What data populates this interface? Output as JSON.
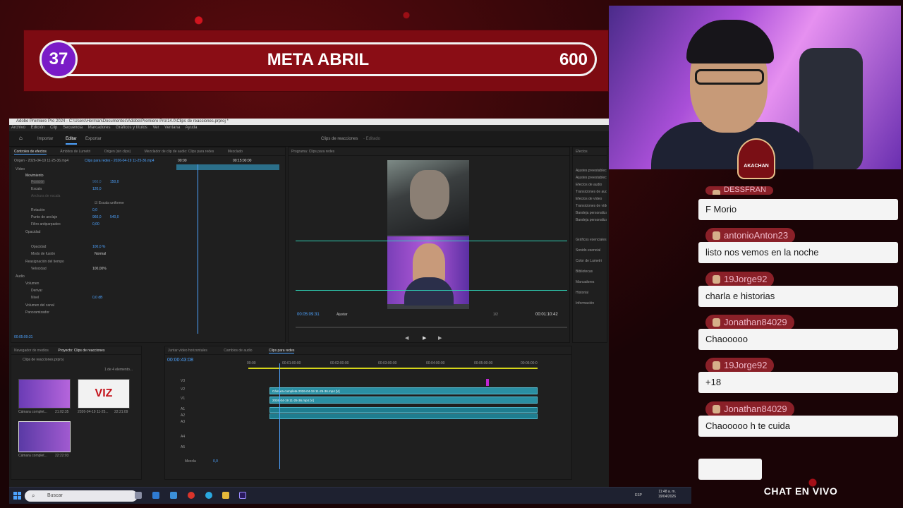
{
  "goal": {
    "current": "37",
    "title": "META ABRIL",
    "target": "600"
  },
  "premiere": {
    "window_title": "Adobe Premiere Pro 2024 - C:\\Users\\Herman\\Documentos\\Adobe\\Premiere Pro\\14.0\\Clips de reacciones.prproj *",
    "menu": [
      "Archivo",
      "Edición",
      "Clip",
      "Secuencia",
      "Marcadores",
      "Gráficos y títulos",
      "Ver",
      "Ventana",
      "Ayuda"
    ],
    "workspace_tabs": {
      "inicio": "⌂",
      "importar": "Importar",
      "editar": "Editar",
      "exportar": "Exportar"
    },
    "project_name": "Clips de reacciones",
    "edited": "- Editado",
    "effects_controls": {
      "tabs": [
        "Controles de efectos",
        "Ámbitos de Lumetri",
        "Origen (sin clips)",
        "Mezclador de clip de audio: Clips para redes",
        "Mezclado"
      ],
      "source": "Origen - 2026-04-19 11-25-36.mp4",
      "sequence": "Clips para redes - 2026-04-19 11-25-36.mp4",
      "ruler_start": "00:00",
      "ruler_mid": "00:15:00:00",
      "rows": {
        "video": "Vídeo",
        "movimiento": "Movimiento",
        "posicion": "Posición",
        "posicion_x": "960,0",
        "posicion_y": "150,0",
        "escala": "Escala",
        "escala_val": "120,0",
        "ancho_escala": "Anchura de escala",
        "escala_uniforme": "Escala uniforme",
        "rotacion": "Rotación",
        "rotacion_val": "0,0",
        "punto_anclaje": "Punto de anclaje",
        "punto_x": "960,0",
        "punto_y": "540,0",
        "filtro": "Filtro antiparpadeo",
        "filtro_val": "0,00",
        "opacidad": "Opacidad",
        "opacidad_row": "Opacidad",
        "opacidad_val": "100,0 %",
        "modo_fusion": "Modo de fusión",
        "modo_val": "Normal",
        "reasignacion": "Reasignación del tiempo",
        "velocidad": "Velocidad",
        "velocidad_val": "100,00%",
        "audio": "Audio",
        "volumen": "Volumen",
        "derivar": "Derivar",
        "nivel": "Nivel",
        "nivel_val": "0,0 dB",
        "volumen_canal": "Volumen del canal",
        "panoramizador": "Panoramizador"
      },
      "timecode": "00:05:09:31"
    },
    "program": {
      "title": "Programa: Clips para redes",
      "timecode": "00:05:09:31",
      "fit": "Ajustar",
      "ratio": "1/2",
      "duration": "00:01:10:42"
    },
    "effects_panel": {
      "title": "Efectos",
      "folders": [
        "Ajustes preestablecidos",
        "Ajustes preestablecidos de Lumetri",
        "Efectos de audio",
        "Transiciones de audio",
        "Efectos de vídeo",
        "Transiciones de vídeo",
        "Bandeja personalizada 01",
        "Bandeja personalizada 02"
      ],
      "sections": [
        "Gráficos esenciales",
        "Sonido esencial",
        "Color de Lumetri",
        "Bibliotecas",
        "Marcadores",
        "Historial",
        "Información"
      ]
    },
    "project_panel": {
      "tabs": [
        "Navegador de medios",
        "Proyecto: Clips de reacciones"
      ],
      "file": "Clips de reacciones.prproj",
      "count": "1 de 4 elemento...",
      "items": [
        {
          "name": "Cámara complet...",
          "dur": "21:02:35"
        },
        {
          "name": "2026-04-19 11-25...",
          "dur": "22:21:09"
        },
        {
          "name": "Cámara complet...",
          "dur": "22:22:03"
        }
      ],
      "thumb_text": "VIZ"
    },
    "timeline": {
      "tabs": [
        "Juntar vídeo horizontales",
        "Cambios de audio",
        "Clips para redes"
      ],
      "timecode": "00:00:43:08",
      "ruler": [
        "00:00",
        "00:01:00:00",
        "00:02:00:00",
        "00:03:00:00",
        "00:04:00:00",
        "00:05:00:00",
        "00:06:00:0"
      ],
      "tracks_video": [
        "V3",
        "V2",
        "V1"
      ],
      "tracks_audio": [
        "A1",
        "A2",
        "A3",
        "A4",
        "A5"
      ],
      "clip_v2": "Cámara completa 2026-04-19 11-25-36.mp4 [V]",
      "clip_v1": "2026-04-19 11-25-36.mp4 [V]",
      "mix": "Mezcla",
      "mix_val": "0,0"
    }
  },
  "chat": {
    "partial_name": "DESSFRAN",
    "messages": [
      {
        "user": "",
        "text": "F Morio"
      },
      {
        "user": "antonioAnton23",
        "text": "listo nos vemos en la noche"
      },
      {
        "user": "19Jorge92",
        "text": "charla e historias"
      },
      {
        "user": "Jonathan84029",
        "text": "Chaooooo"
      },
      {
        "user": "19Jorge92",
        "text": "+18"
      },
      {
        "user": "Jonathan84029",
        "text": "Chaooooo h te cuida"
      }
    ],
    "footer": "CHAT EN VIVO"
  },
  "webcam": {
    "badge": "AKACHAN"
  },
  "taskbar": {
    "search_placeholder": "Buscar",
    "time": "11:48 a. m.",
    "date": "19/04/2026",
    "lang": "ESP"
  },
  "colors": {
    "goal_bg": "#7d0b12",
    "goal_circle": "#7a1bc7",
    "chat_name": "#8a2028",
    "accent_blue": "#4da3ff",
    "clip": "#2a8fa3"
  }
}
